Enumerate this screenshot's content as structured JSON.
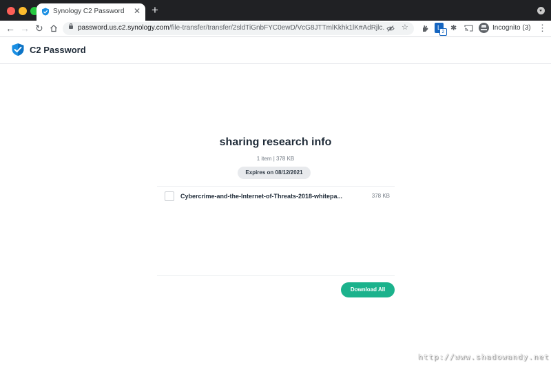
{
  "browser": {
    "tab_title": "Synology C2 Password",
    "tab_close": "✕",
    "new_tab": "+",
    "url_host": "password.us.c2.synology.com",
    "url_path": "/file-transfer/transfer/2sldTiGnbFYC0ewD/VcG8JTTmlKkhk1lK#AdRjlc...",
    "incognito_label": "Incognito (3)",
    "extension_badge_letter": "L",
    "extension_badge_count": "2"
  },
  "app": {
    "brand_name": "C2 Password",
    "brand_color": "#1a8fe3"
  },
  "transfer": {
    "title": "sharing research info",
    "meta": "1 item | 378 KB",
    "expires": "Expires on 08/12/2021",
    "files": [
      {
        "name": "Cybercrime-and-the-Internet-of-Threats-2018-whitepa...",
        "size": "378 KB",
        "selected": false
      }
    ],
    "download_all_label": "Download All",
    "accent_color": "#1bb28c"
  },
  "watermark": "http://www.shadowandy.net"
}
